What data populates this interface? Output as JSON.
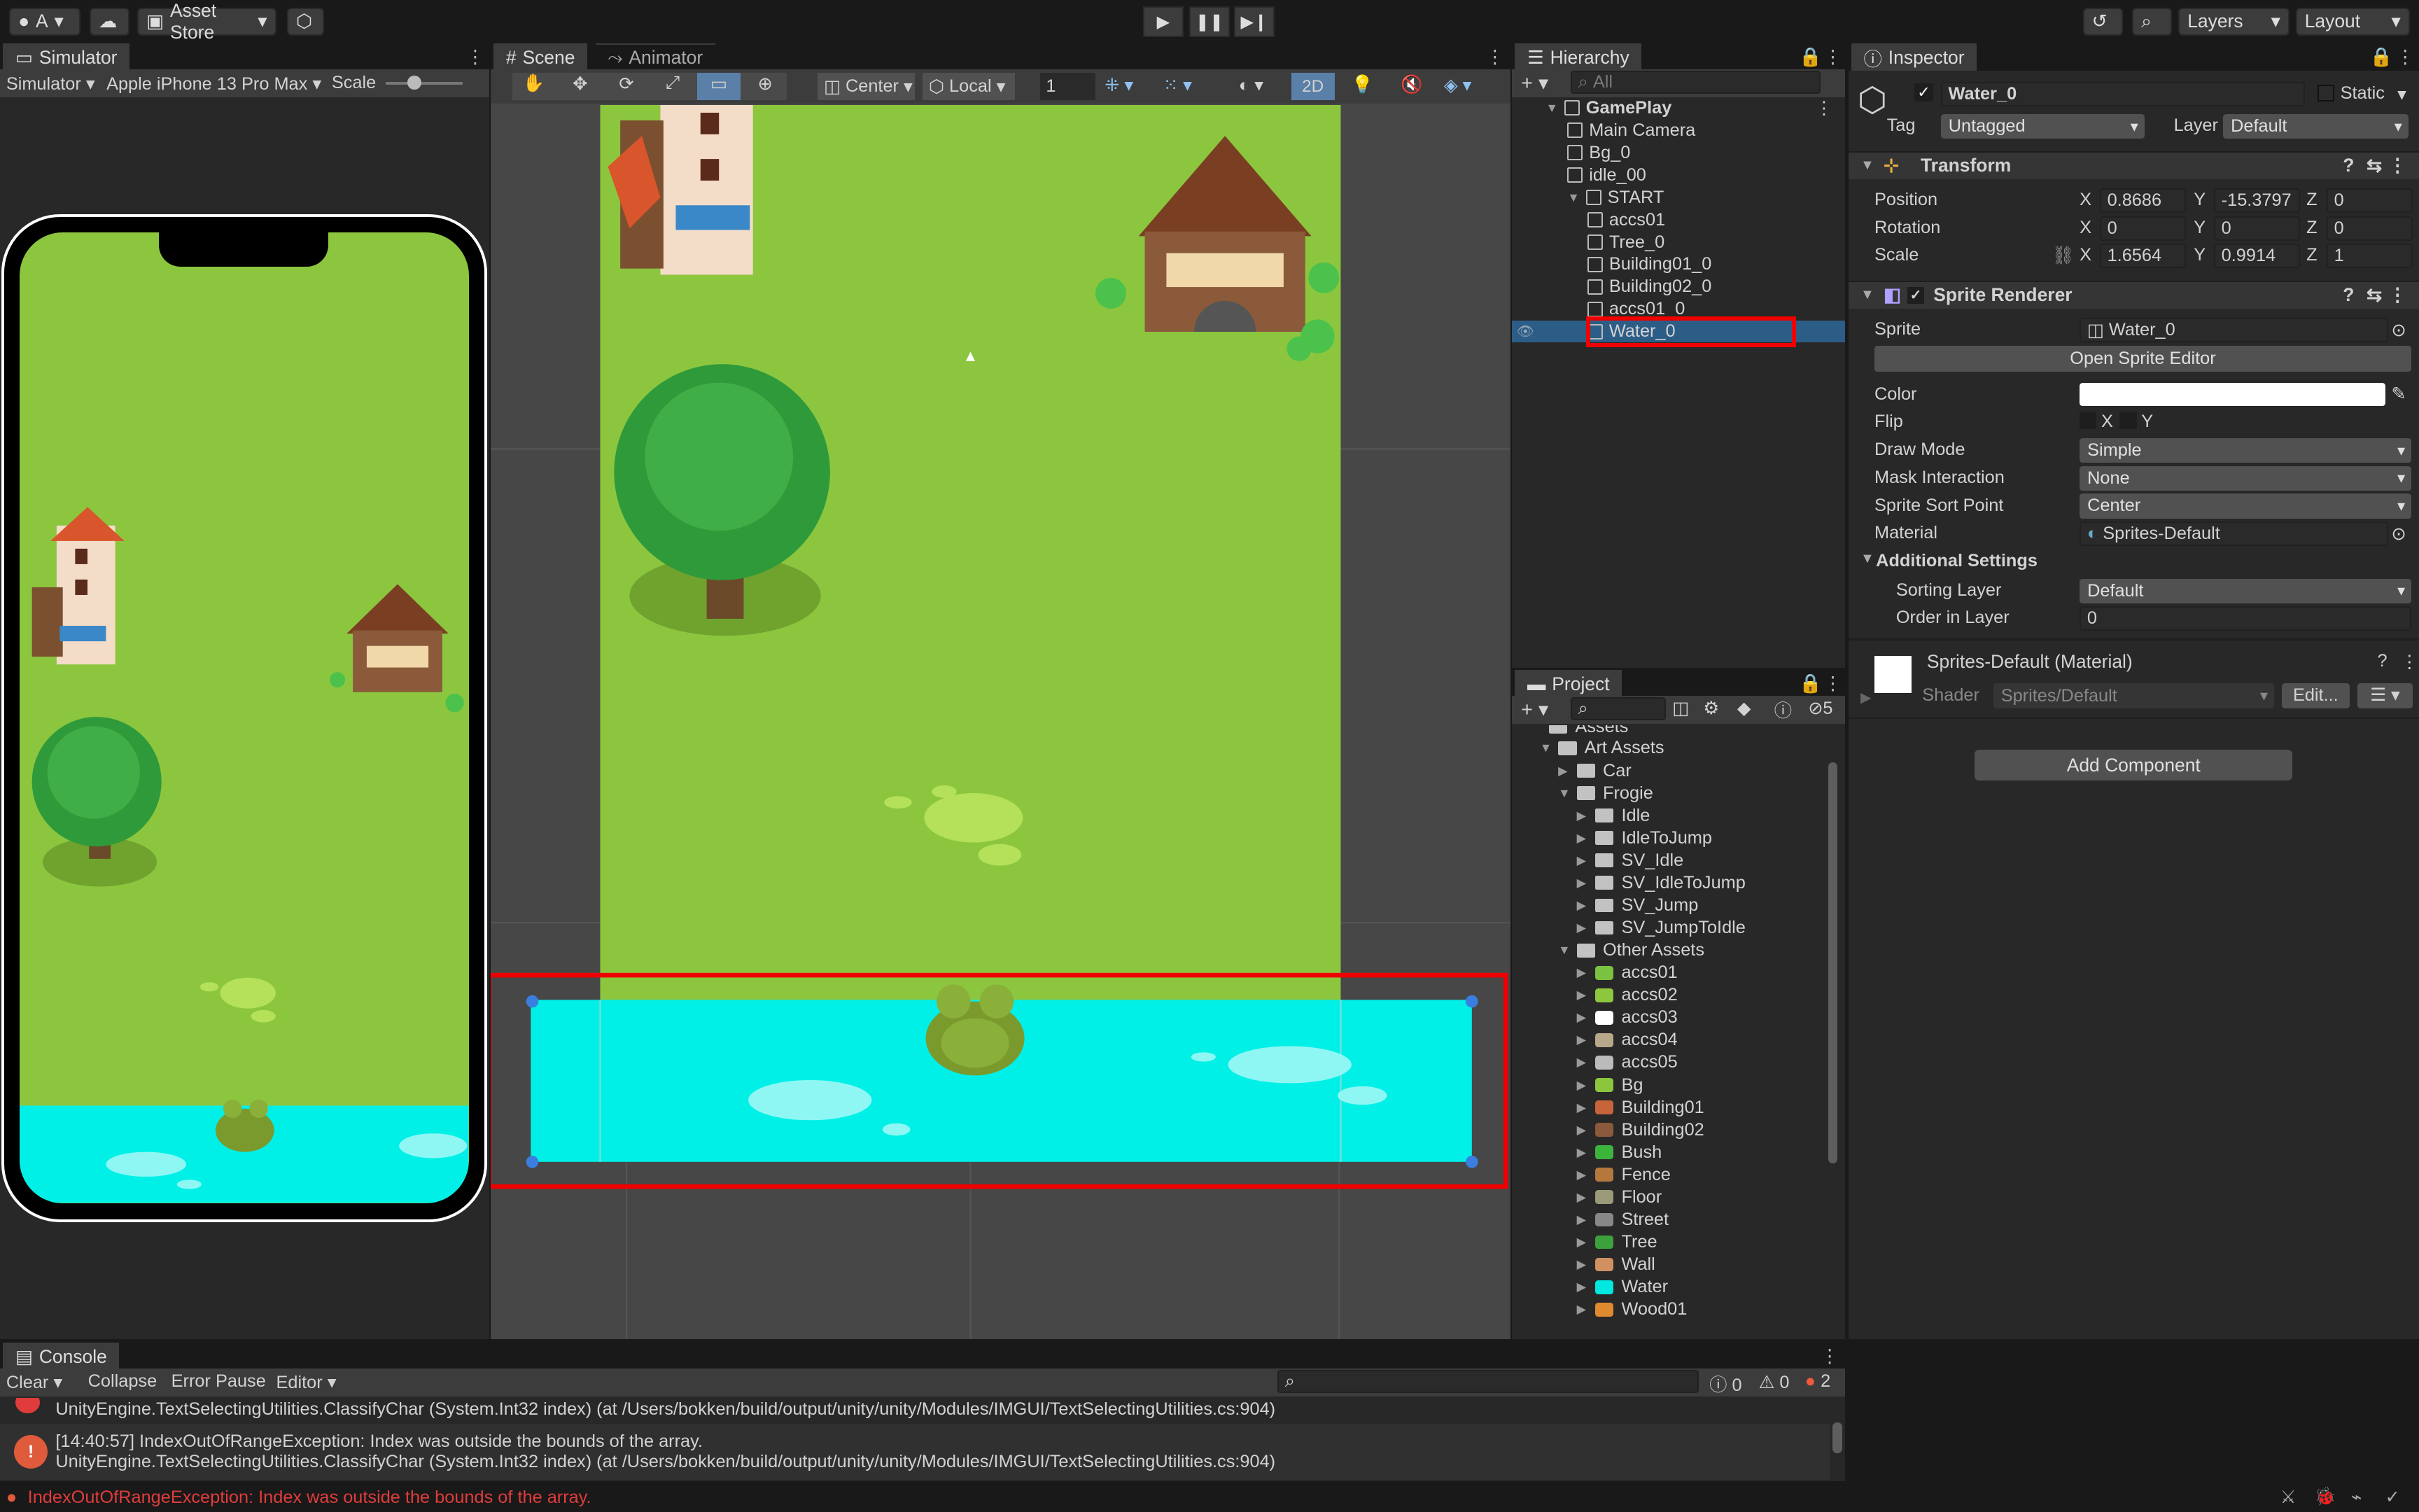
{
  "toolbar": {
    "account": "A",
    "asset_store": "Asset Store",
    "layers": "Layers",
    "layout": "Layout"
  },
  "simulator": {
    "tab": "Simulator",
    "mode": "Simulator",
    "device": "Apple iPhone 13 Pro Max",
    "scale_label": "Scale"
  },
  "scene": {
    "tab_scene": "Scene",
    "tab_animator": "Animator",
    "pivot": "Center",
    "space": "Local",
    "snap_value": "1",
    "mode_2d": "2D"
  },
  "hierarchy": {
    "tab": "Hierarchy",
    "search": "All",
    "items": [
      {
        "label": "GamePlay",
        "depth": 0
      },
      {
        "label": "Main Camera",
        "depth": 1
      },
      {
        "label": "Bg_0",
        "depth": 1
      },
      {
        "label": "idle_00",
        "depth": 1
      },
      {
        "label": "START",
        "depth": 1
      },
      {
        "label": "accs01",
        "depth": 2
      },
      {
        "label": "Tree_0",
        "depth": 2
      },
      {
        "label": "Building01_0",
        "depth": 2
      },
      {
        "label": "Building02_0",
        "depth": 2
      },
      {
        "label": "accs01_0",
        "depth": 2
      },
      {
        "label": "Water_0",
        "depth": 2
      }
    ]
  },
  "project": {
    "tab": "Project",
    "hidden_count": "5",
    "root": "Assets",
    "items": [
      {
        "label": "Art Assets",
        "depth": 0,
        "open": true,
        "color": "#c2c2c2"
      },
      {
        "label": "Car",
        "depth": 1,
        "color": "#c2c2c2"
      },
      {
        "label": "Frogie",
        "depth": 1,
        "open": true,
        "color": "#c2c2c2"
      },
      {
        "label": "Idle",
        "depth": 2,
        "color": "#c2c2c2"
      },
      {
        "label": "IdleToJump",
        "depth": 2,
        "color": "#c2c2c2"
      },
      {
        "label": "SV_Idle",
        "depth": 2,
        "color": "#c2c2c2"
      },
      {
        "label": "SV_IdleToJump",
        "depth": 2,
        "color": "#c2c2c2"
      },
      {
        "label": "SV_Jump",
        "depth": 2,
        "color": "#c2c2c2"
      },
      {
        "label": "SV_JumpToIdle",
        "depth": 2,
        "color": "#c2c2c2"
      },
      {
        "label": "Other Assets",
        "depth": 1,
        "open": true,
        "color": "#c2c2c2"
      },
      {
        "label": "accs01",
        "depth": 2,
        "color": "#7cc242"
      },
      {
        "label": "accs02",
        "depth": 2,
        "color": "#8dc63f"
      },
      {
        "label": "accs03",
        "depth": 2,
        "color": "#ffffff"
      },
      {
        "label": "accs04",
        "depth": 2,
        "color": "#b8a88a"
      },
      {
        "label": "accs05",
        "depth": 2,
        "color": "#bbbbbb"
      },
      {
        "label": "Bg",
        "depth": 2,
        "color": "#8cc63f"
      },
      {
        "label": "Building01",
        "depth": 2,
        "color": "#c8643c"
      },
      {
        "label": "Building02",
        "depth": 2,
        "color": "#8b5a3c"
      },
      {
        "label": "Bush",
        "depth": 2,
        "color": "#3cb43c"
      },
      {
        "label": "Fence",
        "depth": 2,
        "color": "#b4783c"
      },
      {
        "label": "Floor",
        "depth": 2,
        "color": "#9a9a7a"
      },
      {
        "label": "Street",
        "depth": 2,
        "color": "#888888"
      },
      {
        "label": "Tree",
        "depth": 2,
        "color": "#3ca03c"
      },
      {
        "label": "Wall",
        "depth": 2,
        "color": "#d09060"
      },
      {
        "label": "Water",
        "depth": 2,
        "color": "#00e8e0"
      },
      {
        "label": "Wood01",
        "depth": 2,
        "color": "#e08a30"
      }
    ]
  },
  "inspector": {
    "tab": "Inspector",
    "name": "Water_0",
    "static": "Static",
    "tag_label": "Tag",
    "tag": "Untagged",
    "layer_label": "Layer",
    "layer": "Default",
    "transform": {
      "title": "Transform",
      "position_label": "Position",
      "rotation_label": "Rotation",
      "scale_label": "Scale",
      "pos": [
        "0.8686",
        "-15.3797",
        "0"
      ],
      "rot": [
        "0",
        "0",
        "0"
      ],
      "scale": [
        "1.6564",
        "0.9914",
        "1"
      ]
    },
    "sprite_renderer": {
      "title": "Sprite Renderer",
      "sprite_label": "Sprite",
      "sprite": "Water_0",
      "open_editor": "Open Sprite Editor",
      "color_label": "Color",
      "flip_label": "Flip",
      "draw_mode_label": "Draw Mode",
      "draw_mode": "Simple",
      "mask_label": "Mask Interaction",
      "mask": "None",
      "sort_point_label": "Sprite Sort Point",
      "sort_point": "Center",
      "material_label": "Material",
      "material": "Sprites-Default",
      "additional": "Additional Settings",
      "sorting_layer_label": "Sorting Layer",
      "sorting_layer": "Default",
      "order_label": "Order in Layer",
      "order": "0"
    },
    "material": {
      "title": "Sprites-Default (Material)",
      "shader_label": "Shader",
      "shader": "Sprites/Default",
      "edit": "Edit..."
    },
    "add_component": "Add Component"
  },
  "console": {
    "tab": "Console",
    "clear": "Clear",
    "collapse": "Collapse",
    "error_pause": "Error Pause",
    "editor": "Editor",
    "count_log": "0",
    "count_warn": "0",
    "count_err": "2",
    "line0": "UnityEngine.TextSelectingUtilities.ClassifyChar (System.Int32 index) (at /Users/bokken/build/output/unity/unity/Modules/IMGUI/TextSelectingUtilities.cs:904)",
    "line1a": "[14:40:57] IndexOutOfRangeException: Index was outside the bounds of the array.",
    "line1b": "UnityEngine.TextSelectingUtilities.ClassifyChar (System.Int32 index) (at /Users/bokken/build/output/unity/unity/Modules/IMGUI/TextSelectingUtilities.cs:904)"
  },
  "status": {
    "message": "IndexOutOfRangeException: Index was outside the bounds of the array."
  },
  "colors": {
    "accent": "#2c5d87",
    "error": "#e03c3c",
    "water": "#00f0e8",
    "grass": "#8cc63f"
  }
}
